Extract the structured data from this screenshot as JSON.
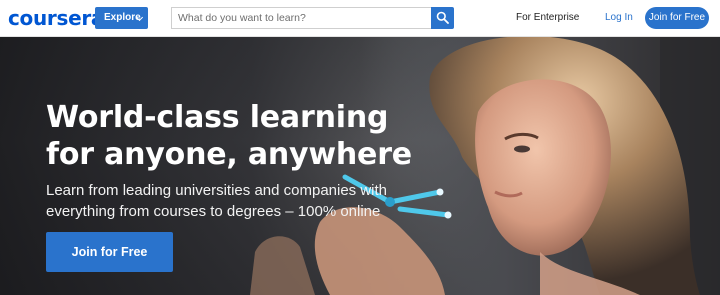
{
  "header": {
    "logo_text": "coursera",
    "explore_label": "Explore",
    "search_placeholder": "What do you want to learn?",
    "enterprise_label": "For Enterprise",
    "login_label": "Log In",
    "join_label": "Join for Free"
  },
  "hero": {
    "title": "World-class learning for anyone, anywhere",
    "subtitle": "Learn from leading universities and companies with everything from courses to degrees – 100% online",
    "cta_label": "Join for Free"
  },
  "colors": {
    "brand": "#0056d2",
    "primary_button": "#2a73cc",
    "hero_text": "#ffffff"
  },
  "icons": {
    "search": "search-icon",
    "explore_chevron": "chevron-down-icon"
  }
}
